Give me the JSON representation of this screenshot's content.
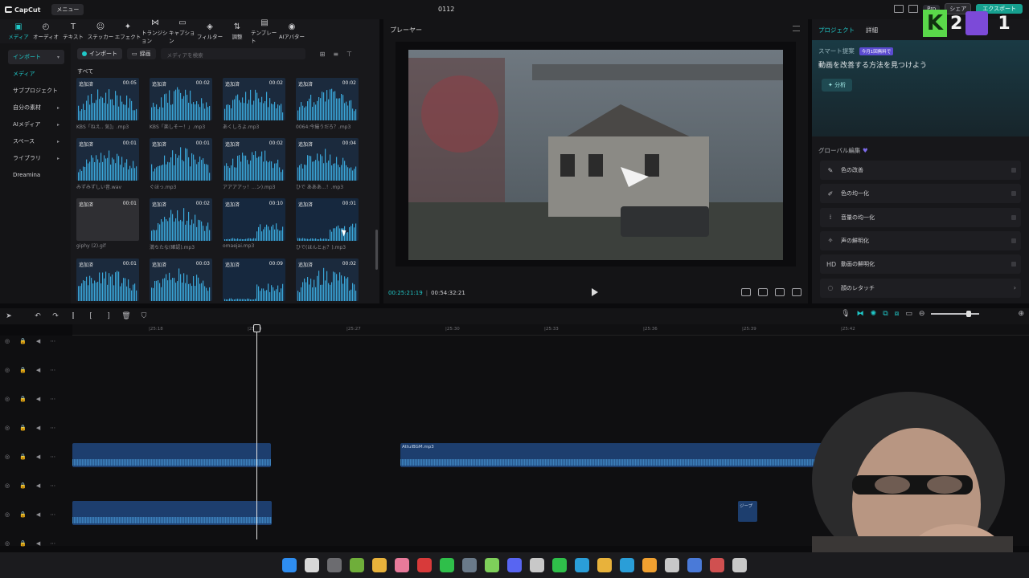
{
  "app": {
    "logo_text": "CapCut",
    "menu_label": "メニュー",
    "window_title": "0112",
    "pro_label": "Pro",
    "share_label": "シェア",
    "export_label": "エクスポート"
  },
  "media_tools": [
    {
      "label": "メディア",
      "icon": "media-icon",
      "glyph": "▣"
    },
    {
      "label": "オーディオ",
      "icon": "audio-icon",
      "glyph": "◴"
    },
    {
      "label": "テキスト",
      "icon": "text-icon",
      "glyph": "T"
    },
    {
      "label": "ステッカー",
      "icon": "sticker-icon",
      "glyph": "☺"
    },
    {
      "label": "エフェクト",
      "icon": "effect-icon",
      "glyph": "✦"
    },
    {
      "label": "トランジション",
      "icon": "transition-icon",
      "glyph": "⋈"
    },
    {
      "label": "キャプション",
      "icon": "caption-icon",
      "glyph": "▭"
    },
    {
      "label": "フィルター",
      "icon": "filter-icon",
      "glyph": "◈"
    },
    {
      "label": "調整",
      "icon": "adjust-icon",
      "glyph": "⇅"
    },
    {
      "label": "テンプレート",
      "icon": "template-icon",
      "glyph": "▤"
    },
    {
      "label": "AIアバター",
      "icon": "avatar-icon",
      "glyph": "◉"
    }
  ],
  "sidebar": {
    "items": [
      {
        "label": "インポート",
        "state": "active",
        "caret": "▾"
      },
      {
        "label": "メディア",
        "state": "sub",
        "caret": ""
      },
      {
        "label": "サブプロジェクト",
        "state": "",
        "caret": ""
      },
      {
        "label": "自分の素材",
        "state": "",
        "caret": "▸"
      },
      {
        "label": "AIメディア",
        "state": "",
        "caret": "▸"
      },
      {
        "label": "スペース",
        "state": "",
        "caret": "▸"
      },
      {
        "label": "ライブラリ",
        "state": "",
        "caret": "▸"
      },
      {
        "label": "Dreamina",
        "state": "",
        "caret": ""
      }
    ]
  },
  "media": {
    "import_label": "インポート",
    "record_label": "録画",
    "search_placeholder": "メディアを検索",
    "section_all": "すべて",
    "added_label": "追加済",
    "cards": [
      {
        "duration": "00:05",
        "name": "KBS「ねえ.. 気]」.mp3",
        "kind": "audio"
      },
      {
        "duration": "00:02",
        "name": "KBS「楽しそー！」.mp3",
        "kind": "audio"
      },
      {
        "duration": "00:02",
        "name": "あくしろよ.mp3",
        "kind": "audio"
      },
      {
        "duration": "00:02",
        "name": "0064:今撮うだろ？.mp3",
        "kind": "audio"
      },
      {
        "duration": "00:01",
        "name": "みずみずしい音.wav",
        "kind": "audio"
      },
      {
        "duration": "00:01",
        "name": "ぐほっ.mp3",
        "kind": "audio"
      },
      {
        "duration": "00:02",
        "name": "アアアアッ！...ン).mp3",
        "kind": "audio"
      },
      {
        "duration": "00:04",
        "name": "ひで あああ...！.mp3",
        "kind": "audio"
      },
      {
        "duration": "00:01",
        "name": "giphy (2).gif",
        "kind": "gif"
      },
      {
        "duration": "00:02",
        "name": "満ちたな(確認).mp3",
        "kind": "audio"
      },
      {
        "duration": "00:10",
        "name": "omaejai.mp3",
        "kind": "audio-dark"
      },
      {
        "duration": "00:01",
        "name": "ひで(ほんとぉ？).mp3",
        "kind": "audio-dark"
      },
      {
        "duration": "00:01",
        "name": "",
        "kind": "audio"
      },
      {
        "duration": "00:03",
        "name": "",
        "kind": "audio"
      },
      {
        "duration": "00:09",
        "name": "",
        "kind": "audio-dark"
      },
      {
        "duration": "00:02",
        "name": "",
        "kind": "audio"
      }
    ]
  },
  "player": {
    "title": "プレーヤー",
    "current_time": "00:25:21:19",
    "total_time": "00:54:32:21"
  },
  "right_panel": {
    "tab_project": "プロジェクト",
    "tab_detail": "詳細",
    "smart_title": "スマート提案",
    "smart_badge": "今月1回無料で",
    "smart_sub": "動画を改善する方法を見つけよう",
    "analyze_label": "分析",
    "global_title": "グローバル編集",
    "global_items": [
      {
        "label": "色の改善",
        "icon": "color-enhance-icon",
        "glyph": "✎",
        "end": "toggle"
      },
      {
        "label": "色の均一化",
        "icon": "color-match-icon",
        "glyph": "✐",
        "end": "toggle"
      },
      {
        "label": "音量の均一化",
        "icon": "volume-normalize-icon",
        "glyph": "⁞",
        "end": "toggle"
      },
      {
        "label": "声の鮮明化",
        "icon": "voice-enhance-icon",
        "glyph": "✧",
        "end": "toggle"
      },
      {
        "label": "動画の鮮明化",
        "icon": "hd-icon",
        "glyph": "HD",
        "end": "toggle"
      },
      {
        "label": "顔のレタッチ",
        "icon": "face-retouch-icon",
        "glyph": "◌",
        "end": "arrow"
      }
    ]
  },
  "overlay": {
    "k_letter": "K",
    "k_number": "2",
    "right_number": "1"
  },
  "timeline": {
    "ruler": [
      {
        "label": "|25:18"
      },
      {
        "label": "|25:24"
      },
      {
        "label": "|25:27"
      },
      {
        "label": "|25:30"
      },
      {
        "label": "|25:33"
      },
      {
        "label": "|25:36"
      },
      {
        "label": "|25:39"
      },
      {
        "label": "|25:42"
      }
    ],
    "clip_bgm": "AttulBGM.mp3",
    "clip_small": "ジープ"
  },
  "colors": {
    "accent": "#20c9c9",
    "clip": "#1d3e6e",
    "waveform": "#3f86c2"
  }
}
